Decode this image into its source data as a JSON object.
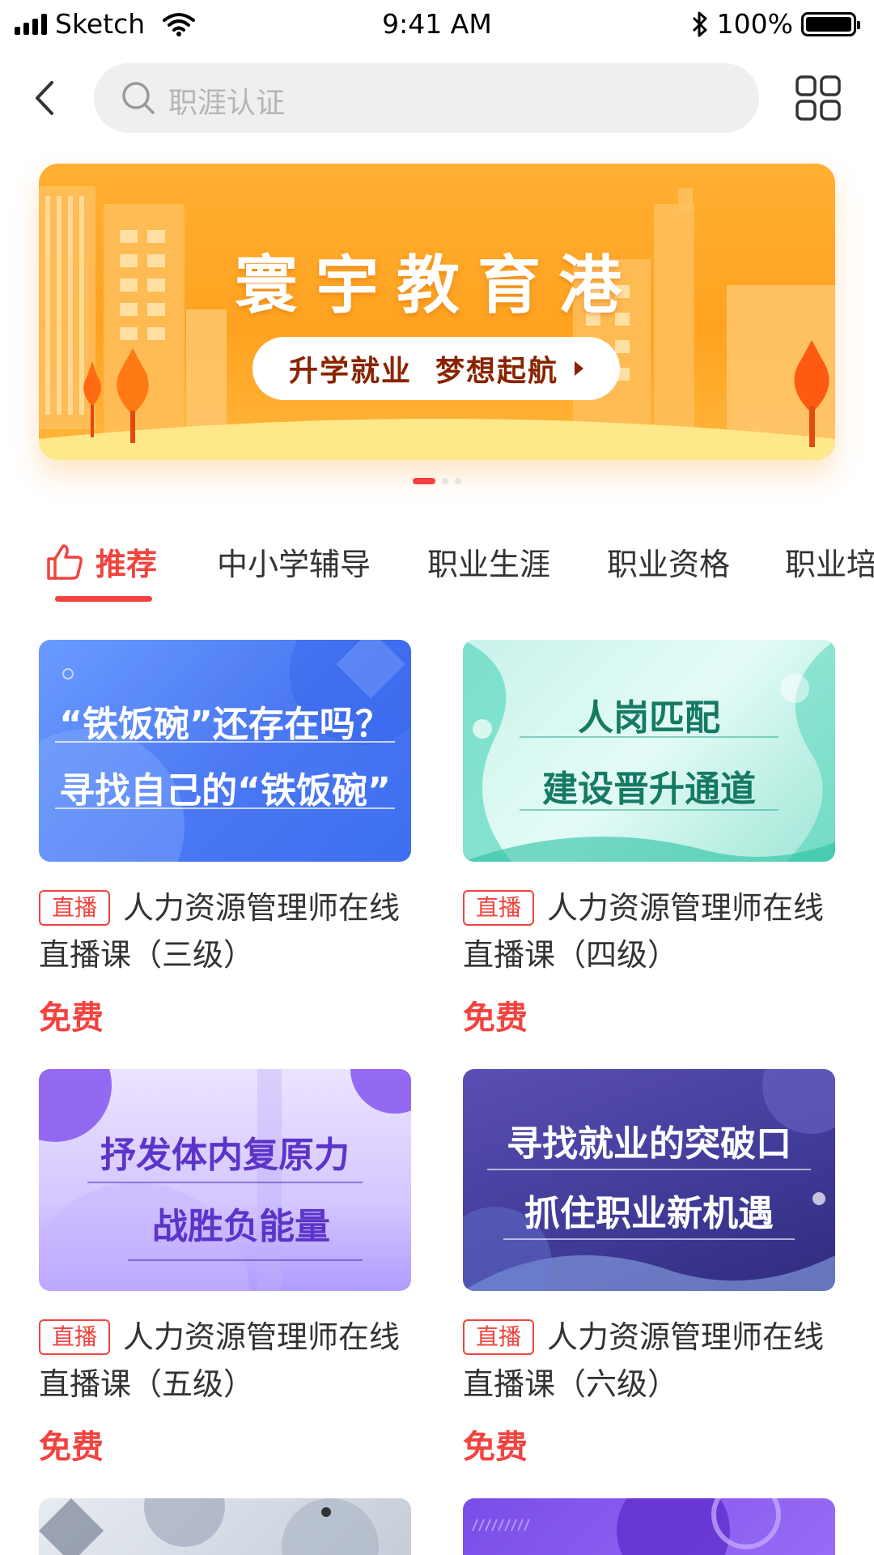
{
  "status_bar": {
    "carrier": "Sketch",
    "time": "9:41 AM",
    "battery": "100%",
    "battery_level": 1.0,
    "icons": [
      "signal-bars-icon",
      "wifi-icon",
      "bluetooth-icon",
      "battery-icon"
    ]
  },
  "header": {
    "search_placeholder": "职涯认证",
    "icons": [
      "back-icon",
      "search-icon",
      "grid-icon"
    ]
  },
  "banner": {
    "title": "寰宇教育港",
    "pill_text": "升学就业  梦想起航",
    "slide_count": 3,
    "active_slide": 1,
    "colors": {
      "background": "#ffa21f",
      "pill_text": "#8a2300"
    }
  },
  "tabs": {
    "items": [
      "推荐",
      "中小学辅导",
      "职业生涯",
      "职业资格",
      "职业培训"
    ],
    "active_index": 0,
    "accent_color": "#f2433f"
  },
  "cards": [
    {
      "thumb_lines": [
        "“铁饭碗”还存在吗？",
        "寻找自己的“铁饭碗”"
      ],
      "badge": "直播",
      "title": "人力资源管理师在线直播课（三级）",
      "price": "免费",
      "theme": "blue"
    },
    {
      "thumb_lines": [
        "人岗匹配",
        "建设晋升通道"
      ],
      "badge": "直播",
      "title": "人力资源管理师在线直播课（四级）",
      "price": "免费",
      "theme": "teal"
    },
    {
      "thumb_lines": [
        "抒发体内复原力",
        "战胜负能量"
      ],
      "badge": "直播",
      "title": "人力资源管理师在线直播课（五级）",
      "price": "免费",
      "theme": "lavender"
    },
    {
      "thumb_lines": [
        "寻找就业的突破口",
        "抓住职业新机遇"
      ],
      "badge": "直播",
      "title": "人力资源管理师在线直播课（六级）",
      "price": "免费",
      "theme": "indigo"
    }
  ]
}
